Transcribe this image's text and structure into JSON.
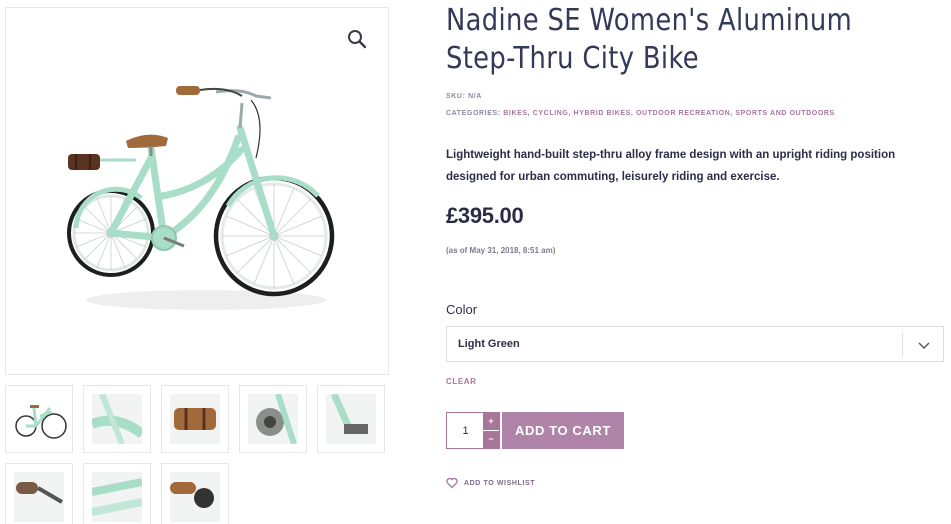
{
  "product": {
    "title": "Nadine SE Women's Aluminum Step-Thru City Bike",
    "sku_label": "SKU:",
    "sku_value": "N/A",
    "categories_label": "CATEGORIES:",
    "categories": [
      "BIKES",
      "CYCLING",
      "HYBRID BIKES",
      "OUTDOOR RECREATION",
      "SPORTS AND OUTDOORS"
    ],
    "description": "Lightweight hand-built step-thru alloy frame design with an upright riding position designed for urban commuting, leisurely riding and exercise.",
    "price": "£395.00",
    "price_note": "(as of May 31, 2018, 8:51 am)"
  },
  "variation": {
    "color_label": "Color",
    "selected": "Light Green",
    "clear_label": "CLEAR"
  },
  "cart": {
    "quantity": "1",
    "plus": "+",
    "minus": "−",
    "add_to_cart": "ADD TO CART"
  },
  "wishlist": {
    "label": "ADD TO WISHLIST"
  },
  "gallery": {
    "thumbnails": [
      "bike-full",
      "frame-detail",
      "rear-rack-bag",
      "gear-hub",
      "pedal-detail",
      "brake-lever",
      "frame-tubes",
      "handlebar-grip"
    ]
  },
  "colors": {
    "accent": "#b083a9",
    "accent_text": "#a7769b",
    "bike_frame": "#a8ddc7",
    "heading": "#34395a"
  }
}
